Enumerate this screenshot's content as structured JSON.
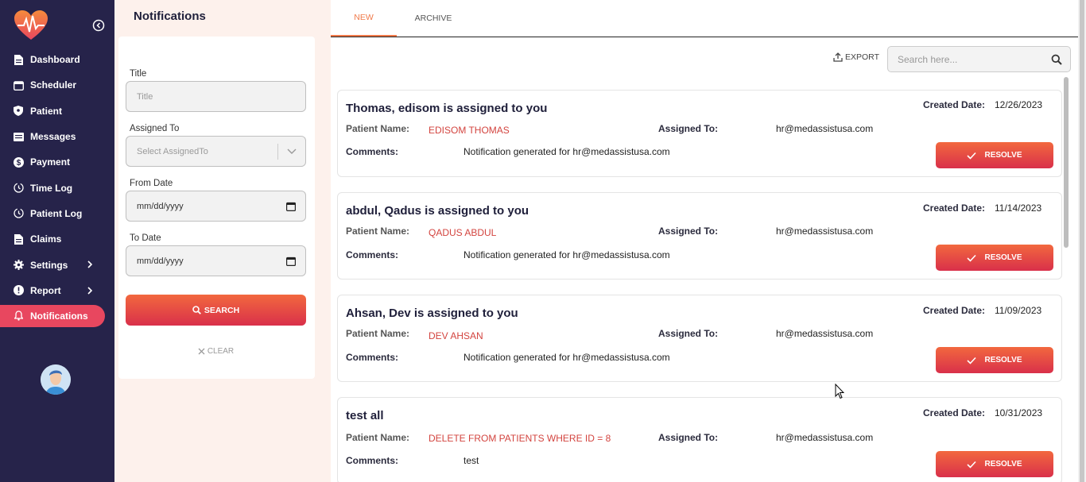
{
  "sidebar": {
    "items": [
      {
        "label": "Dashboard",
        "icon": "file-icon"
      },
      {
        "label": "Scheduler",
        "icon": "calendar-icon"
      },
      {
        "label": "Patient",
        "icon": "shield-icon"
      },
      {
        "label": "Messages",
        "icon": "message-icon"
      },
      {
        "label": "Payment",
        "icon": "dollar-icon"
      },
      {
        "label": "Time Log",
        "icon": "clock-icon"
      },
      {
        "label": "Patient Log",
        "icon": "clock-icon"
      },
      {
        "label": "Claims",
        "icon": "file-icon"
      },
      {
        "label": "Settings",
        "icon": "gear-icon"
      },
      {
        "label": "Report",
        "icon": "alert-icon"
      },
      {
        "label": "Notifications",
        "icon": "bell-icon"
      }
    ]
  },
  "filter": {
    "heading": "Notifications",
    "title_label": "Title",
    "title_placeholder": "Title",
    "assigned_label": "Assigned To",
    "assigned_placeholder": "Select AssignedTo",
    "from_label": "From Date",
    "from_value": "mm/dd/yyyy",
    "to_label": "To Date",
    "to_value": "mm/dd/yyyy",
    "search_label": "SEARCH",
    "clear_label": "CLEAR"
  },
  "tabs": {
    "new": "NEW",
    "archive": "ARCHIVE"
  },
  "toolbar": {
    "export_label": "EXPORT",
    "search_placeholder": "Search here..."
  },
  "labels": {
    "created": "Created Date:",
    "patient": "Patient Name:",
    "assigned": "Assigned To:",
    "comments": "Comments:",
    "resolve": "RESOLVE"
  },
  "notifications": [
    {
      "title": "Thomas, edisom is assigned to you",
      "created": "12/26/2023",
      "patient": "EDISOM THOMAS",
      "assigned": "hr@medassistusa.com",
      "comment": "Notification generated for hr@medassistusa.com"
    },
    {
      "title": "abdul, Qadus is assigned to you",
      "created": "11/14/2023",
      "patient": "QADUS ABDUL",
      "assigned": "hr@medassistusa.com",
      "comment": "Notification generated for hr@medassistusa.com"
    },
    {
      "title": "Ahsan, Dev is assigned to you",
      "created": "11/09/2023",
      "patient": "DEV AHSAN",
      "assigned": "hr@medassistusa.com",
      "comment": "Notification generated for hr@medassistusa.com"
    },
    {
      "title": "test all",
      "created": "10/31/2023",
      "patient": "DELETE FROM PATIENTS WHERE ID = 8",
      "assigned": "hr@medassistusa.com",
      "comment": "test"
    }
  ],
  "colors": {
    "sidebar": "#26234a",
    "active": "#e8475f",
    "accent": "#f07a4a"
  }
}
